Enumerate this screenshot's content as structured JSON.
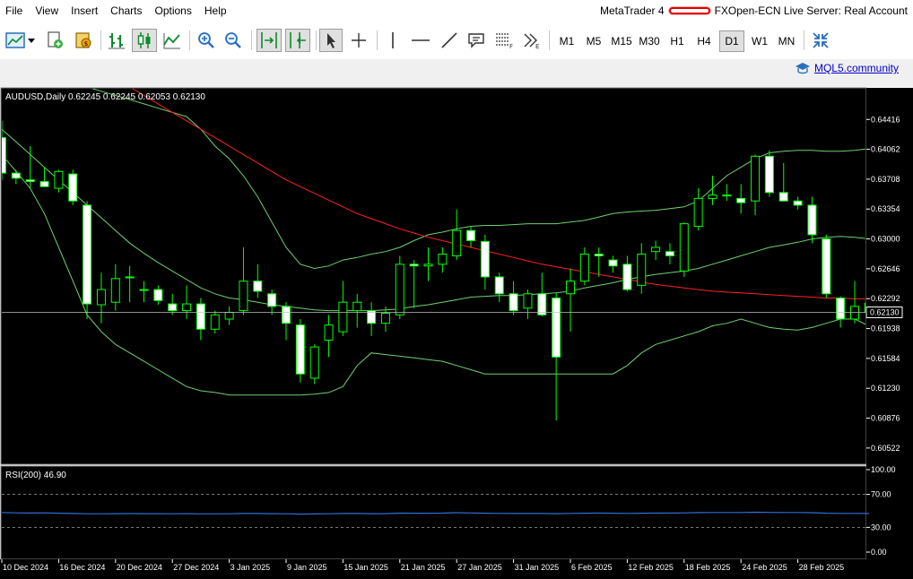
{
  "menu": [
    "File",
    "View",
    "Insert",
    "Charts",
    "Options",
    "Help"
  ],
  "window": {
    "app_name": "MetaTrader 4",
    "server_info": "FXOpen-ECN Live Server: Real Account"
  },
  "toolbar": {
    "timeframes": [
      "M1",
      "M5",
      "M15",
      "M30",
      "H1",
      "H4",
      "D1",
      "W1",
      "MN"
    ],
    "active_timeframe": "D1"
  },
  "community_link": "MQL5.community",
  "colors": {
    "candle_up": "#00ff00",
    "candle_bull_body": "#000000",
    "candle_bear_body": "#ffffff",
    "bollinger": "#6fd06f",
    "moving_average": "#ff2020",
    "rsi_line": "#2f6fd8",
    "background": "#000000",
    "axis_text": "#ffffff"
  },
  "chart_data": [
    {
      "type": "candlestick",
      "title": "AUDUSD,Daily  0.62245 0.62245 0.62053 0.62130",
      "current_price": "0.62130",
      "ylim": [
        0.6034,
        0.6478
      ],
      "y_ticks": [
        "0.64416",
        "0.64062",
        "0.63708",
        "0.63354",
        "0.63000",
        "0.62646",
        "0.62292",
        "0.61938",
        "0.61584",
        "0.61230",
        "0.60876",
        "0.60522"
      ],
      "x_labels": [
        "10 Dec 2024",
        "16 Dec 2024",
        "20 Dec 2024",
        "27 Dec 2024",
        "3 Jan 2025",
        "9 Jan 2025",
        "15 Jan 2025",
        "21 Jan 2025",
        "27 Jan 2025",
        "31 Jan 2025",
        "6 Feb 2025",
        "12 Feb 2025",
        "18 Feb 2025",
        "24 Feb 2025",
        "28 Feb 2025"
      ],
      "candles": [
        {
          "o": 0.642,
          "h": 0.644,
          "l": 0.637,
          "c": 0.6378
        },
        {
          "o": 0.6378,
          "h": 0.6382,
          "l": 0.6365,
          "c": 0.6372
        },
        {
          "o": 0.637,
          "h": 0.641,
          "l": 0.636,
          "c": 0.6368
        },
        {
          "o": 0.6368,
          "h": 0.6385,
          "l": 0.6362,
          "c": 0.6362
        },
        {
          "o": 0.636,
          "h": 0.6382,
          "l": 0.6355,
          "c": 0.638
        },
        {
          "o": 0.6377,
          "h": 0.6382,
          "l": 0.634,
          "c": 0.6345
        },
        {
          "o": 0.634,
          "h": 0.6345,
          "l": 0.6205,
          "c": 0.6223
        },
        {
          "o": 0.6222,
          "h": 0.626,
          "l": 0.62,
          "c": 0.624
        },
        {
          "o": 0.6225,
          "h": 0.627,
          "l": 0.6215,
          "c": 0.6253
        },
        {
          "o": 0.6255,
          "h": 0.6268,
          "l": 0.6225,
          "c": 0.6255
        },
        {
          "o": 0.624,
          "h": 0.625,
          "l": 0.6225,
          "c": 0.624
        },
        {
          "o": 0.624,
          "h": 0.6245,
          "l": 0.6222,
          "c": 0.6227
        },
        {
          "o": 0.6223,
          "h": 0.6235,
          "l": 0.621,
          "c": 0.6215
        },
        {
          "o": 0.6215,
          "h": 0.6245,
          "l": 0.6205,
          "c": 0.6223
        },
        {
          "o": 0.6223,
          "h": 0.623,
          "l": 0.618,
          "c": 0.6193
        },
        {
          "o": 0.6193,
          "h": 0.6215,
          "l": 0.6188,
          "c": 0.621
        },
        {
          "o": 0.6205,
          "h": 0.622,
          "l": 0.6198,
          "c": 0.6213
        },
        {
          "o": 0.6215,
          "h": 0.629,
          "l": 0.621,
          "c": 0.625
        },
        {
          "o": 0.625,
          "h": 0.627,
          "l": 0.623,
          "c": 0.6238
        },
        {
          "o": 0.6235,
          "h": 0.624,
          "l": 0.621,
          "c": 0.622
        },
        {
          "o": 0.622,
          "h": 0.6225,
          "l": 0.618,
          "c": 0.62
        },
        {
          "o": 0.6198,
          "h": 0.6205,
          "l": 0.613,
          "c": 0.614
        },
        {
          "o": 0.6135,
          "h": 0.6175,
          "l": 0.6128,
          "c": 0.6172
        },
        {
          "o": 0.618,
          "h": 0.621,
          "l": 0.616,
          "c": 0.6198
        },
        {
          "o": 0.619,
          "h": 0.625,
          "l": 0.6185,
          "c": 0.6225
        },
        {
          "o": 0.6215,
          "h": 0.6235,
          "l": 0.6195,
          "c": 0.6225
        },
        {
          "o": 0.6215,
          "h": 0.6225,
          "l": 0.6185,
          "c": 0.62
        },
        {
          "o": 0.62,
          "h": 0.622,
          "l": 0.619,
          "c": 0.6212
        },
        {
          "o": 0.621,
          "h": 0.628,
          "l": 0.6205,
          "c": 0.627
        },
        {
          "o": 0.627,
          "h": 0.6275,
          "l": 0.6218,
          "c": 0.6268
        },
        {
          "o": 0.6268,
          "h": 0.629,
          "l": 0.625,
          "c": 0.627
        },
        {
          "o": 0.627,
          "h": 0.629,
          "l": 0.626,
          "c": 0.6282
        },
        {
          "o": 0.628,
          "h": 0.6335,
          "l": 0.6275,
          "c": 0.631
        },
        {
          "o": 0.631,
          "h": 0.6315,
          "l": 0.629,
          "c": 0.6298
        },
        {
          "o": 0.6297,
          "h": 0.6305,
          "l": 0.624,
          "c": 0.6255
        },
        {
          "o": 0.6255,
          "h": 0.626,
          "l": 0.6225,
          "c": 0.6235
        },
        {
          "o": 0.6235,
          "h": 0.625,
          "l": 0.621,
          "c": 0.6215
        },
        {
          "o": 0.6218,
          "h": 0.624,
          "l": 0.6205,
          "c": 0.6235
        },
        {
          "o": 0.6235,
          "h": 0.626,
          "l": 0.6208,
          "c": 0.621
        },
        {
          "o": 0.623,
          "h": 0.6236,
          "l": 0.6085,
          "c": 0.616
        },
        {
          "o": 0.6235,
          "h": 0.6265,
          "l": 0.619,
          "c": 0.625
        },
        {
          "o": 0.625,
          "h": 0.629,
          "l": 0.6245,
          "c": 0.6282
        },
        {
          "o": 0.6282,
          "h": 0.629,
          "l": 0.6255,
          "c": 0.628
        },
        {
          "o": 0.6275,
          "h": 0.628,
          "l": 0.626,
          "c": 0.6268
        },
        {
          "o": 0.627,
          "h": 0.628,
          "l": 0.6238,
          "c": 0.624
        },
        {
          "o": 0.6245,
          "h": 0.6295,
          "l": 0.6235,
          "c": 0.6282
        },
        {
          "o": 0.6285,
          "h": 0.6298,
          "l": 0.6275,
          "c": 0.629
        },
        {
          "o": 0.6285,
          "h": 0.6295,
          "l": 0.627,
          "c": 0.628
        },
        {
          "o": 0.6262,
          "h": 0.632,
          "l": 0.6255,
          "c": 0.6318
        },
        {
          "o": 0.6315,
          "h": 0.636,
          "l": 0.631,
          "c": 0.6348
        },
        {
          "o": 0.6348,
          "h": 0.6375,
          "l": 0.634,
          "c": 0.6352
        },
        {
          "o": 0.6352,
          "h": 0.6365,
          "l": 0.6345,
          "c": 0.6352
        },
        {
          "o": 0.6348,
          "h": 0.6365,
          "l": 0.633,
          "c": 0.6343
        },
        {
          "o": 0.6345,
          "h": 0.64,
          "l": 0.6328,
          "c": 0.6398
        },
        {
          "o": 0.6398,
          "h": 0.6405,
          "l": 0.635,
          "c": 0.6355
        },
        {
          "o": 0.6355,
          "h": 0.639,
          "l": 0.6345,
          "c": 0.6345
        },
        {
          "o": 0.6345,
          "h": 0.635,
          "l": 0.6335,
          "c": 0.634
        },
        {
          "o": 0.634,
          "h": 0.635,
          "l": 0.6295,
          "c": 0.6305
        },
        {
          "o": 0.63,
          "h": 0.6305,
          "l": 0.623,
          "c": 0.6235
        },
        {
          "o": 0.623,
          "h": 0.6232,
          "l": 0.6195,
          "c": 0.6205
        },
        {
          "o": 0.6205,
          "h": 0.625,
          "l": 0.62,
          "c": 0.622
        },
        {
          "o": 0.6224,
          "h": 0.6225,
          "l": 0.6205,
          "c": 0.6213
        }
      ],
      "bollinger_upper": [
        0.656,
        0.6545,
        0.653,
        0.6515,
        0.65,
        0.649,
        0.648,
        0.6475,
        0.647,
        0.6465,
        0.646,
        0.6455,
        0.645,
        0.6445,
        0.643,
        0.641,
        0.6395,
        0.6375,
        0.635,
        0.632,
        0.629,
        0.627,
        0.6265,
        0.6268,
        0.6275,
        0.6278,
        0.6282,
        0.6285,
        0.629,
        0.6298,
        0.6305,
        0.6308,
        0.6312,
        0.6315,
        0.6316,
        0.6316,
        0.6317,
        0.6318,
        0.6318,
        0.6318,
        0.632,
        0.6322,
        0.6326,
        0.633,
        0.6332,
        0.6333,
        0.6334,
        0.6336,
        0.6338,
        0.6345,
        0.636,
        0.6375,
        0.6385,
        0.6395,
        0.6402,
        0.6404,
        0.6405,
        0.6405,
        0.6404,
        0.6404,
        0.6405,
        0.6407
      ],
      "bollinger_middle": [
        0.643,
        0.6415,
        0.64,
        0.6385,
        0.637,
        0.6355,
        0.634,
        0.6325,
        0.631,
        0.6295,
        0.6283,
        0.6272,
        0.6262,
        0.6252,
        0.6242,
        0.6235,
        0.623,
        0.6228,
        0.6225,
        0.6222,
        0.622,
        0.6218,
        0.6216,
        0.6215,
        0.6215,
        0.6215,
        0.6215,
        0.6216,
        0.6217,
        0.622,
        0.6222,
        0.6225,
        0.6228,
        0.6231,
        0.6232,
        0.6233,
        0.6233,
        0.6234,
        0.6235,
        0.6236,
        0.6238,
        0.6242,
        0.6245,
        0.6248,
        0.6252,
        0.6255,
        0.6258,
        0.626,
        0.6262,
        0.6265,
        0.627,
        0.6275,
        0.628,
        0.6285,
        0.629,
        0.6293,
        0.6296,
        0.63,
        0.6302,
        0.6303,
        0.6302,
        0.63
      ],
      "bollinger_lower": [
        0.64,
        0.638,
        0.636,
        0.633,
        0.629,
        0.625,
        0.621,
        0.619,
        0.6175,
        0.6165,
        0.6155,
        0.6145,
        0.6135,
        0.6125,
        0.612,
        0.6118,
        0.6115,
        0.6115,
        0.6115,
        0.6115,
        0.6115,
        0.6115,
        0.6116,
        0.6118,
        0.6125,
        0.615,
        0.6165,
        0.6163,
        0.6161,
        0.6159,
        0.6157,
        0.6155,
        0.615,
        0.6145,
        0.614,
        0.614,
        0.614,
        0.614,
        0.614,
        0.614,
        0.614,
        0.614,
        0.614,
        0.614,
        0.615,
        0.6165,
        0.6175,
        0.618,
        0.6185,
        0.619,
        0.6197,
        0.62,
        0.6205,
        0.62,
        0.6195,
        0.6193,
        0.6192,
        0.6195,
        0.62,
        0.6205,
        0.6205,
        0.6197
      ],
      "moving_average": [
        0.658,
        0.657,
        0.656,
        0.655,
        0.654,
        0.653,
        0.6518,
        0.6505,
        0.6492,
        0.648,
        0.647,
        0.646,
        0.645,
        0.644,
        0.643,
        0.642,
        0.641,
        0.64,
        0.639,
        0.638,
        0.637,
        0.6362,
        0.6354,
        0.6346,
        0.6338,
        0.633,
        0.6324,
        0.6318,
        0.6312,
        0.6307,
        0.6302,
        0.6298,
        0.6294,
        0.629,
        0.6286,
        0.6282,
        0.6278,
        0.6274,
        0.627,
        0.6267,
        0.6264,
        0.6261,
        0.6258,
        0.6255,
        0.6252,
        0.6249,
        0.6246,
        0.6244,
        0.6242,
        0.624,
        0.6238,
        0.6237,
        0.6236,
        0.6235,
        0.6234,
        0.6233,
        0.6232,
        0.6231,
        0.623,
        0.623,
        0.6229,
        0.6229
      ]
    },
    {
      "type": "line",
      "title": "RSI(200) 46.90",
      "ylim": [
        0,
        100
      ],
      "y_ticks": [
        "100.00",
        "70.00",
        "30.00",
        "0.00"
      ],
      "levels": [
        70,
        30
      ],
      "values": [
        48.0,
        47.6,
        47.4,
        47.6,
        47.2,
        46.9,
        46.5,
        46.5,
        46.6,
        46.7,
        46.6,
        46.6,
        46.5,
        46.6,
        46.4,
        46.4,
        46.5,
        46.8,
        46.8,
        46.6,
        46.5,
        46.1,
        46.3,
        46.5,
        46.9,
        46.9,
        46.6,
        46.6,
        47.3,
        47.2,
        47.2,
        47.3,
        47.8,
        47.5,
        47.2,
        47.0,
        46.8,
        46.9,
        46.8,
        46.6,
        47.0,
        47.2,
        47.3,
        47.2,
        47.0,
        47.2,
        47.3,
        47.3,
        47.6,
        47.9,
        48.0,
        48.0,
        48.0,
        48.4,
        48.1,
        48.0,
        48.0,
        47.8,
        47.2,
        47.0,
        47.0,
        46.9
      ]
    }
  ]
}
